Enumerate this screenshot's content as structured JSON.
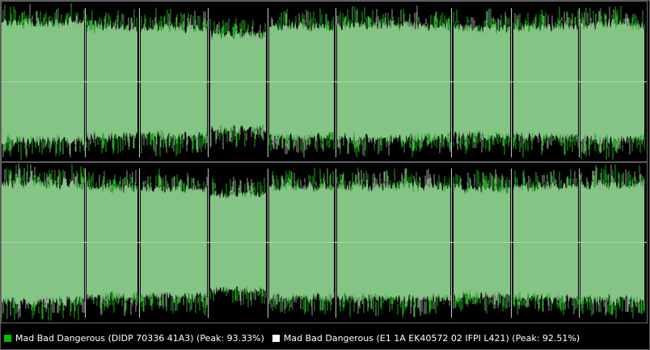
{
  "legend": [
    {
      "name": "Mad Bad Dangerous (DIDP 70336 41A3)",
      "peak_label": "(Peak: 93.33%)",
      "peak": 93.33,
      "color": "#00c000"
    },
    {
      "name": "Mad Bad Dangerous (E1 1A EK40572 02 IFPI L421)",
      "peak_label": "(Peak: 92.51%)",
      "peak": 92.51,
      "color": "#ffffff"
    }
  ],
  "colors": {
    "background": "#000000",
    "fill": "#84c484",
    "series1_stroke": "#1faa1f",
    "series2_stroke": "#9a9a9a",
    "centerline": "#b0d8b0",
    "separator": "#bcbcbc",
    "track_marker": "#e6e6e6"
  },
  "channels": [
    "left-channel",
    "right-channel"
  ],
  "tracks": [
    {
      "start": 0.0,
      "end": 0.128,
      "level": 0.92
    },
    {
      "start": 0.131,
      "end": 0.211,
      "level": 0.86
    },
    {
      "start": 0.216,
      "end": 0.318,
      "level": 0.84
    },
    {
      "start": 0.323,
      "end": 0.41,
      "level": 0.74
    },
    {
      "start": 0.415,
      "end": 0.515,
      "level": 0.86
    },
    {
      "start": 0.52,
      "end": 0.695,
      "level": 0.88
    },
    {
      "start": 0.7,
      "end": 0.788,
      "level": 0.84
    },
    {
      "start": 0.793,
      "end": 0.893,
      "level": 0.86
    },
    {
      "start": 0.897,
      "end": 0.996,
      "level": 0.9
    }
  ],
  "track_boundaries": [
    0.129,
    0.213,
    0.32,
    0.412,
    0.517,
    0.697,
    0.79,
    0.895
  ]
}
